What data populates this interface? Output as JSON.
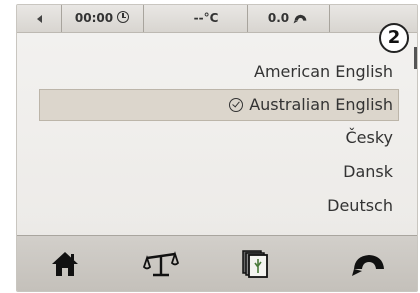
{
  "status_bar": {
    "time": "00:00",
    "temperature": "--°C",
    "consumption": "0.0"
  },
  "step_badge": "2",
  "languages": {
    "items": [
      "American English",
      "Australian English",
      "Česky",
      "Dansk",
      "Deutsch"
    ],
    "selected": "Australian English"
  },
  "nav_bar": {
    "items": [
      "home-icon",
      "balance-icon",
      "pages-icon",
      "eco-car-icon"
    ]
  },
  "colors": {
    "selection_bg": "#dcd6cc",
    "navbar_bg": "#c4c0ba",
    "screen_bg": "#ebe9e6"
  }
}
